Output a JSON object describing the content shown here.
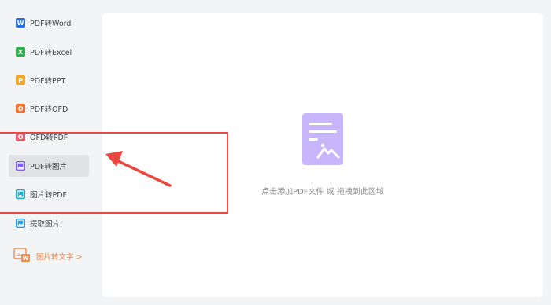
{
  "sidebar": {
    "items": [
      {
        "label": "PDF转Word",
        "icon": "word-icon",
        "badge": "W",
        "color": "#2b6fe0"
      },
      {
        "label": "PDF转Excel",
        "icon": "excel-icon",
        "badge": "X",
        "color": "#2db34a"
      },
      {
        "label": "PDF转PPT",
        "icon": "ppt-icon",
        "badge": "P",
        "color": "#f5a623"
      },
      {
        "label": "PDF转OFD",
        "icon": "ofd-icon",
        "badge": "O",
        "color": "#f26b2b"
      },
      {
        "label": "OFD转PDF",
        "icon": "ofd-to-pdf-icon",
        "badge": "O",
        "color": "#e85a6e"
      },
      {
        "label": "PDF转图片",
        "icon": "image-icon",
        "color": "#7c5cf5",
        "active": true
      },
      {
        "label": "图片转PDF",
        "icon": "image-to-pdf-icon",
        "color": "#1aaec9"
      },
      {
        "label": "提取图片",
        "icon": "extract-image-icon",
        "color": "#2b9ae8"
      }
    ],
    "ocr_link": {
      "label": "图片转文字 >",
      "icon": "ocr-icon",
      "color": "#e8854c"
    }
  },
  "main": {
    "drop_text": "点击添加PDF文件 或 拖拽到此区域",
    "drop_icon": "document-image-icon",
    "accent_color": "#c7b6fb"
  },
  "annotation": {
    "box_color": "#e8483f",
    "arrow_color": "#e8483f"
  }
}
